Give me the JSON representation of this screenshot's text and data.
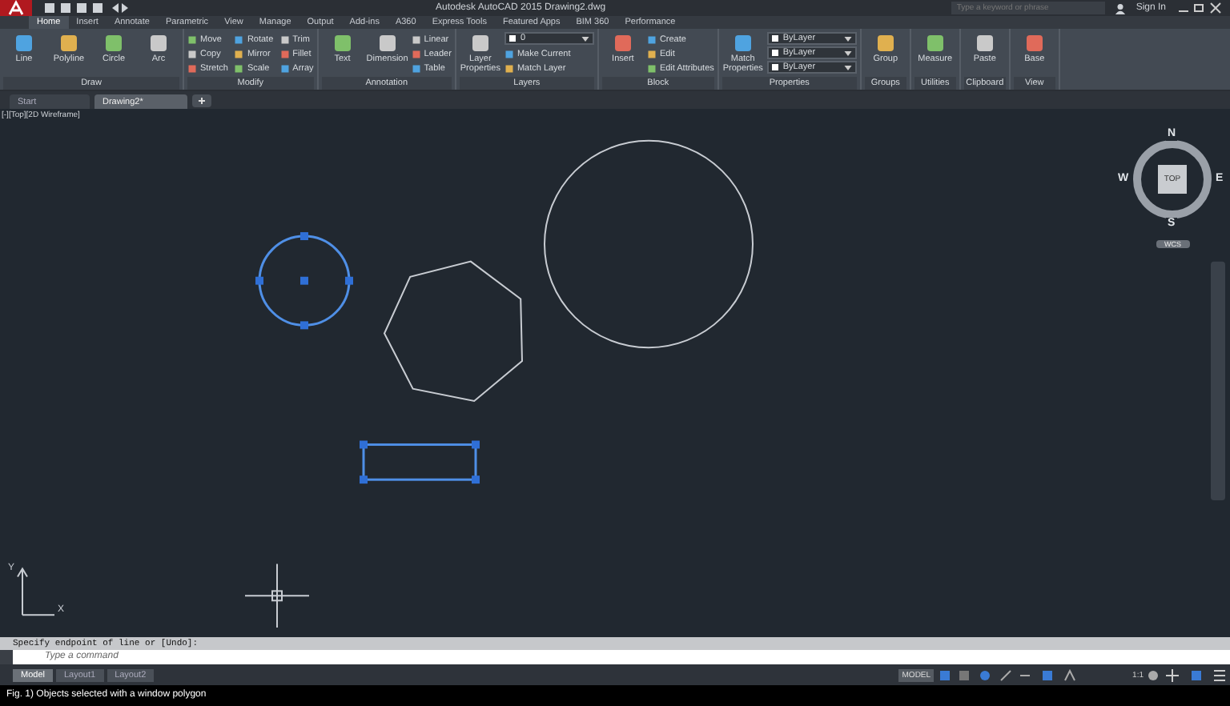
{
  "title_bar": {
    "title": "Autodesk AutoCAD 2015   Drawing2.dwg",
    "search": {
      "placeholder": "Type a keyword or phrase"
    },
    "sign_in": "Sign In"
  },
  "ribbon_tabs": [
    {
      "label": "Home",
      "selected": true
    },
    {
      "label": "Insert",
      "selected": false
    },
    {
      "label": "Annotate",
      "selected": false
    },
    {
      "label": "Parametric",
      "selected": false
    },
    {
      "label": "View",
      "selected": false
    },
    {
      "label": "Manage",
      "selected": false
    },
    {
      "label": "Output",
      "selected": false
    },
    {
      "label": "Add-ins",
      "selected": false
    },
    {
      "label": "A360",
      "selected": false
    },
    {
      "label": "Express Tools",
      "selected": false
    },
    {
      "label": "Featured Apps",
      "selected": false
    },
    {
      "label": "BIM 360",
      "selected": false
    },
    {
      "label": "Performance",
      "selected": false
    }
  ],
  "ribbon_panels": [
    {
      "title": "Draw",
      "items": [
        {
          "kind": "large",
          "label": "Line"
        },
        {
          "kind": "large",
          "label": "Polyline"
        },
        {
          "kind": "large",
          "label": "Circle"
        },
        {
          "kind": "large",
          "label": "Arc"
        }
      ]
    },
    {
      "title": "Modify",
      "items": [
        {
          "kind": "small",
          "label": "Move"
        },
        {
          "kind": "small",
          "label": "Copy"
        },
        {
          "kind": "small",
          "label": "Stretch"
        },
        {
          "kind": "small",
          "label": "Rotate"
        },
        {
          "kind": "small",
          "label": "Mirror"
        },
        {
          "kind": "small",
          "label": "Scale"
        },
        {
          "kind": "small",
          "label": "Trim"
        },
        {
          "kind": "small",
          "label": "Fillet"
        },
        {
          "kind": "small",
          "label": "Array"
        }
      ]
    },
    {
      "title": "Annotation",
      "items": [
        {
          "kind": "large",
          "label": "Text"
        },
        {
          "kind": "large",
          "label": "Dimension"
        },
        {
          "kind": "small",
          "label": "Linear"
        },
        {
          "kind": "small",
          "label": "Leader"
        },
        {
          "kind": "small",
          "label": "Table"
        }
      ]
    },
    {
      "title": "Layers",
      "items": [
        {
          "kind": "large",
          "label": "Layer Properties"
        },
        {
          "kind": "dropdown",
          "label": "0"
        },
        {
          "kind": "small",
          "label": "Make Current"
        },
        {
          "kind": "small",
          "label": "Match Layer"
        }
      ]
    },
    {
      "title": "Block",
      "items": [
        {
          "kind": "large",
          "label": "Insert"
        },
        {
          "kind": "small",
          "label": "Create"
        },
        {
          "kind": "small",
          "label": "Edit"
        },
        {
          "kind": "small",
          "label": "Edit Attributes"
        }
      ]
    },
    {
      "title": "Properties",
      "items": [
        {
          "kind": "large",
          "label": "Match Properties"
        },
        {
          "kind": "dropdown",
          "label": "ByLayer"
        },
        {
          "kind": "dropdown",
          "label": "ByLayer"
        },
        {
          "kind": "dropdown",
          "label": "ByLayer"
        }
      ]
    },
    {
      "title": "Groups",
      "items": [
        {
          "kind": "large",
          "label": "Group"
        }
      ]
    },
    {
      "title": "Utilities",
      "items": [
        {
          "kind": "large",
          "label": "Measure"
        }
      ]
    },
    {
      "title": "Clipboard",
      "items": [
        {
          "kind": "large",
          "label": "Paste"
        }
      ]
    },
    {
      "title": "View",
      "items": [
        {
          "kind": "large",
          "label": "Base"
        }
      ]
    }
  ],
  "file_tabs": [
    {
      "label": "Start",
      "selected": false
    },
    {
      "label": "Drawing2*",
      "selected": true
    }
  ],
  "viewport": {
    "label": "[-][Top][2D Wireframe]",
    "objects": [
      {
        "kind": "circle",
        "selected": true
      },
      {
        "kind": "heptagon",
        "selected": false
      },
      {
        "kind": "circle",
        "selected": false
      },
      {
        "kind": "rectangle",
        "selected": true
      }
    ],
    "ucs_axes": {
      "y": "Y",
      "x": "X"
    },
    "view_cube": {
      "north": "N",
      "east": "E",
      "south": "S",
      "west": "W",
      "face": "TOP",
      "ucs": "WCS"
    }
  },
  "command_line": {
    "history": "Specify endpoint of line or [Undo]:",
    "placeholder": "Type a command"
  },
  "layout_tabs": [
    {
      "label": "Model",
      "selected": true
    },
    {
      "label": "Layout1",
      "selected": false
    },
    {
      "label": "Layout2",
      "selected": false
    }
  ],
  "status_bar": {
    "space": "MODEL",
    "scale": "1:1"
  },
  "caption": "Fig. 1) Objects selected with a window polygon"
}
